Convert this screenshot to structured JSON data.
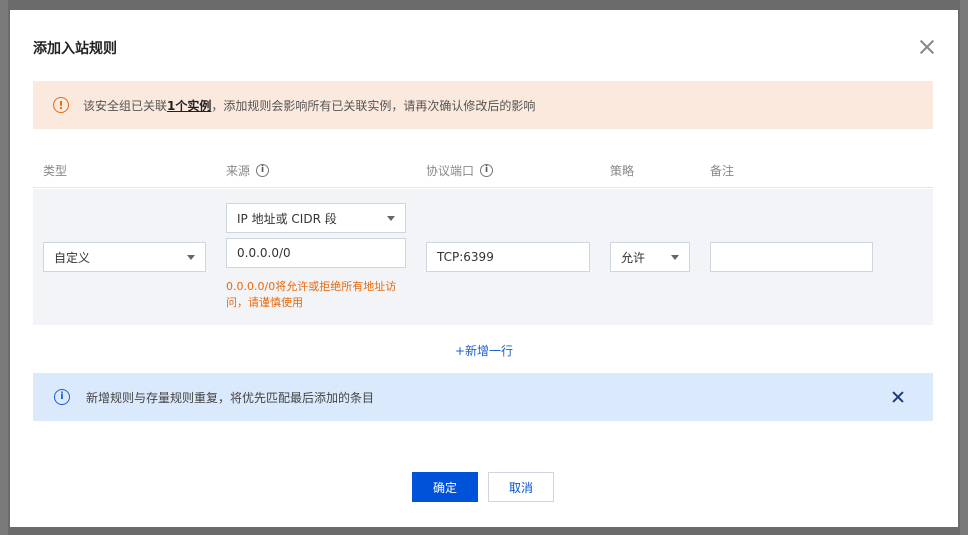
{
  "dialog": {
    "title": "添加入站规则"
  },
  "warning": {
    "prefix": "该安全组已关联",
    "link": "1个实例",
    "suffix": "，添加规则会影响所有已关联实例，请再次确认修改后的影响"
  },
  "table": {
    "headers": {
      "type": "类型",
      "source": "来源",
      "port": "协议端口",
      "policy": "策略",
      "note": "备注"
    },
    "row": {
      "type_value": "自定义",
      "source_type": "IP 地址或 CIDR 段",
      "source_value": "0.0.0.0/0",
      "source_hint": "0.0.0.0/0将允许或拒绝所有地址访问，请谨慎使用",
      "port_value": "TCP:6399",
      "policy_value": "允许",
      "note_value": ""
    }
  },
  "add_row_label": "+新增一行",
  "info": {
    "text": "新增规则与存量规则重复，将优先匹配最后添加的条目"
  },
  "buttons": {
    "ok": "确定",
    "cancel": "取消"
  },
  "colors": {
    "primary": "#0052d9",
    "warning": "#e8690d",
    "warning_bg": "#fbe9dd",
    "info_bg": "#dbe9fd"
  }
}
